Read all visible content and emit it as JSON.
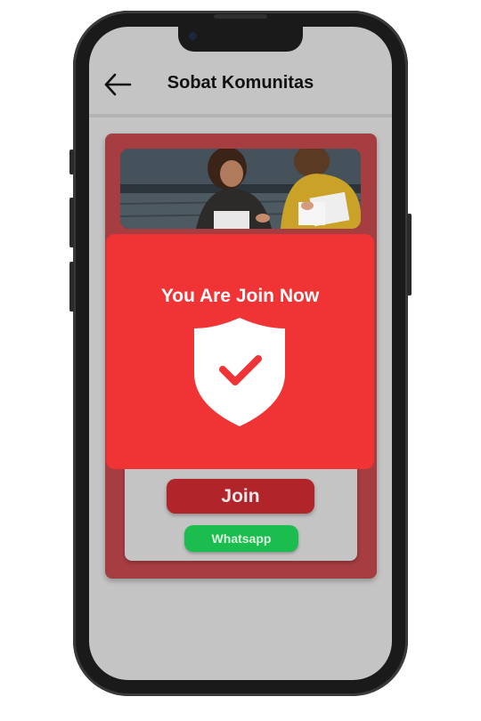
{
  "header": {
    "title": "Sobat Komunitas",
    "back_icon": "arrow-left-icon"
  },
  "community_card": {
    "image": "community-photo",
    "join_label": "Join",
    "whatsapp_label": "Whatsapp"
  },
  "popup": {
    "message": "You Are Join Now",
    "icon": "shield-check-icon"
  },
  "colors": {
    "screen_bg": "#c4c4c4",
    "card_outer": "#a63d41",
    "popup_bg": "#f03335",
    "join_button": "#b0242a",
    "whatsapp_button": "#1bbd4f"
  }
}
